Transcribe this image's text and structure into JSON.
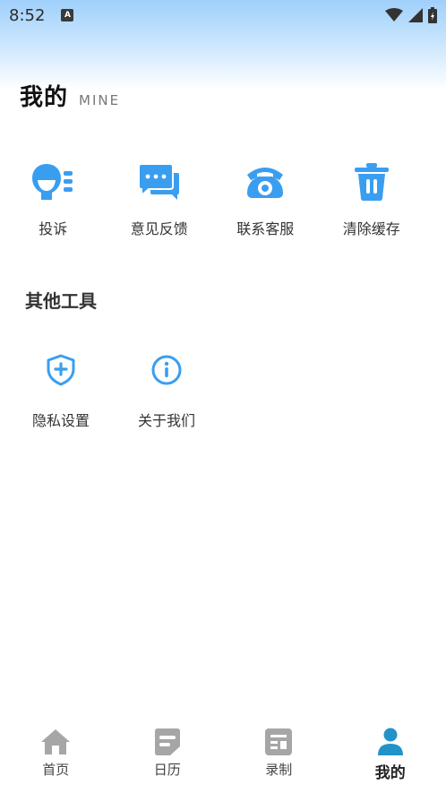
{
  "status": {
    "time": "8:52"
  },
  "header": {
    "title": "我的",
    "subtitle": "MINE"
  },
  "services": [
    {
      "label": "投诉",
      "icon": "complaint-icon"
    },
    {
      "label": "意见反馈",
      "icon": "feedback-chat-icon"
    },
    {
      "label": "联系客服",
      "icon": "telephone-icon"
    },
    {
      "label": "清除缓存",
      "icon": "trash-icon"
    }
  ],
  "other_tools": {
    "title": "其他工具",
    "items": [
      {
        "label": "隐私设置",
        "icon": "shield-plus-icon"
      },
      {
        "label": "关于我们",
        "icon": "info-icon"
      }
    ]
  },
  "nav": [
    {
      "label": "首页",
      "icon": "home-icon"
    },
    {
      "label": "日历",
      "icon": "calendar-icon"
    },
    {
      "label": "录制",
      "icon": "record-icon"
    },
    {
      "label": "我的",
      "icon": "user-icon",
      "active": true
    }
  ],
  "colors": {
    "accent": "#3a9ef0",
    "nav_inactive": "#a6a6a6",
    "nav_active": "#2193c9"
  }
}
